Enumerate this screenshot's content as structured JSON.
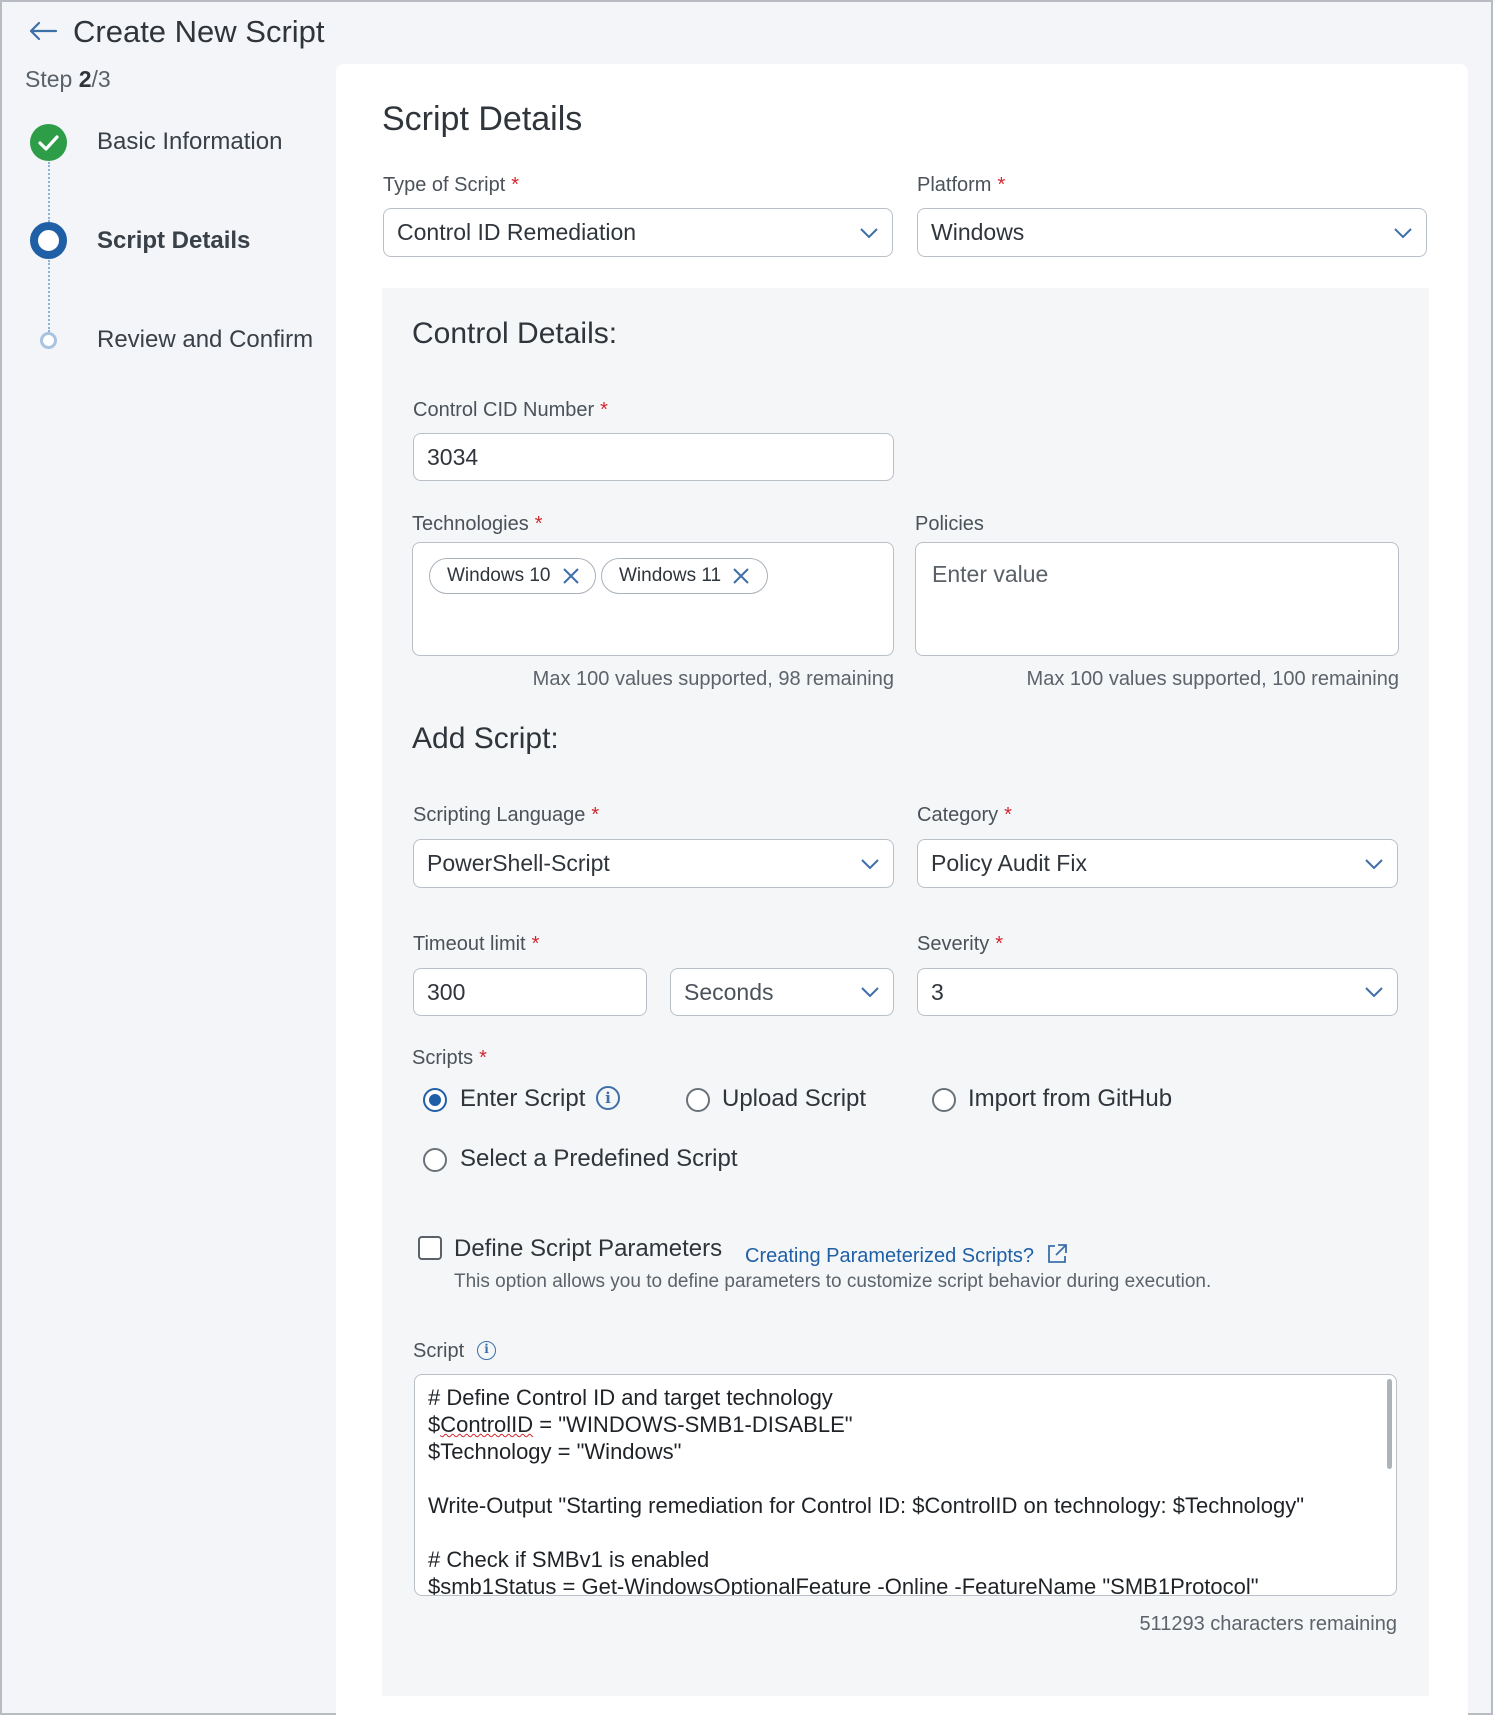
{
  "header": {
    "title": "Create New Script",
    "step_prefix": "Step",
    "step_current": "2",
    "step_total": "/3"
  },
  "stepper": {
    "items": [
      {
        "label": "Basic Information",
        "state": "done"
      },
      {
        "label": "Script Details",
        "state": "current"
      },
      {
        "label": "Review and Confirm",
        "state": "future"
      }
    ]
  },
  "details": {
    "title": "Script Details",
    "type_label": "Type of Script",
    "type_value": "Control ID Remediation",
    "platform_label": "Platform",
    "platform_value": "Windows"
  },
  "control": {
    "title": "Control Details:",
    "cid_label": "Control CID Number",
    "cid_value": "3034",
    "technologies_label": "Technologies",
    "technologies": [
      "Windows 10",
      "Windows 11"
    ],
    "technologies_help": "Max 100 values supported, 98 remaining",
    "policies_label": "Policies",
    "policies_placeholder": "Enter value",
    "policies_help": "Max 100 values supported, 100 remaining"
  },
  "add_script": {
    "title": "Add Script:",
    "language_label": "Scripting Language",
    "language_value": "PowerShell-Script",
    "category_label": "Category",
    "category_value": "Policy Audit Fix",
    "timeout_label": "Timeout limit",
    "timeout_value": "300",
    "timeout_unit": "Seconds",
    "severity_label": "Severity",
    "severity_value": "3",
    "scripts_label": "Scripts",
    "options": [
      "Enter Script",
      "Upload Script",
      "Import from GitHub",
      "Select a Predefined Script"
    ],
    "selected_option": "Enter Script",
    "define_params_label": "Define Script Parameters",
    "define_params_link": "Creating Parameterized Scripts?",
    "define_params_help": "This option allows you to define parameters to customize script behavior during execution.",
    "script_label": "Script",
    "script_lines": [
      "# Define Control ID and target technology",
      "$ControlID = \"WINDOWS-SMB1-DISABLE\"",
      "$Technology = \"Windows\"",
      "",
      "Write-Output \"Starting remediation for Control ID: $ControlID on technology: $Technology\"",
      "",
      "# Check if SMBv1 is enabled",
      "$smb1Status = Get-WindowsOptionalFeature -Online -FeatureName \"SMB1Protocol\""
    ],
    "chars_remaining": "511293 characters remaining"
  },
  "colors": {
    "accent": "#1f5fa5",
    "success": "#2e9d47",
    "required": "#d3252d"
  }
}
